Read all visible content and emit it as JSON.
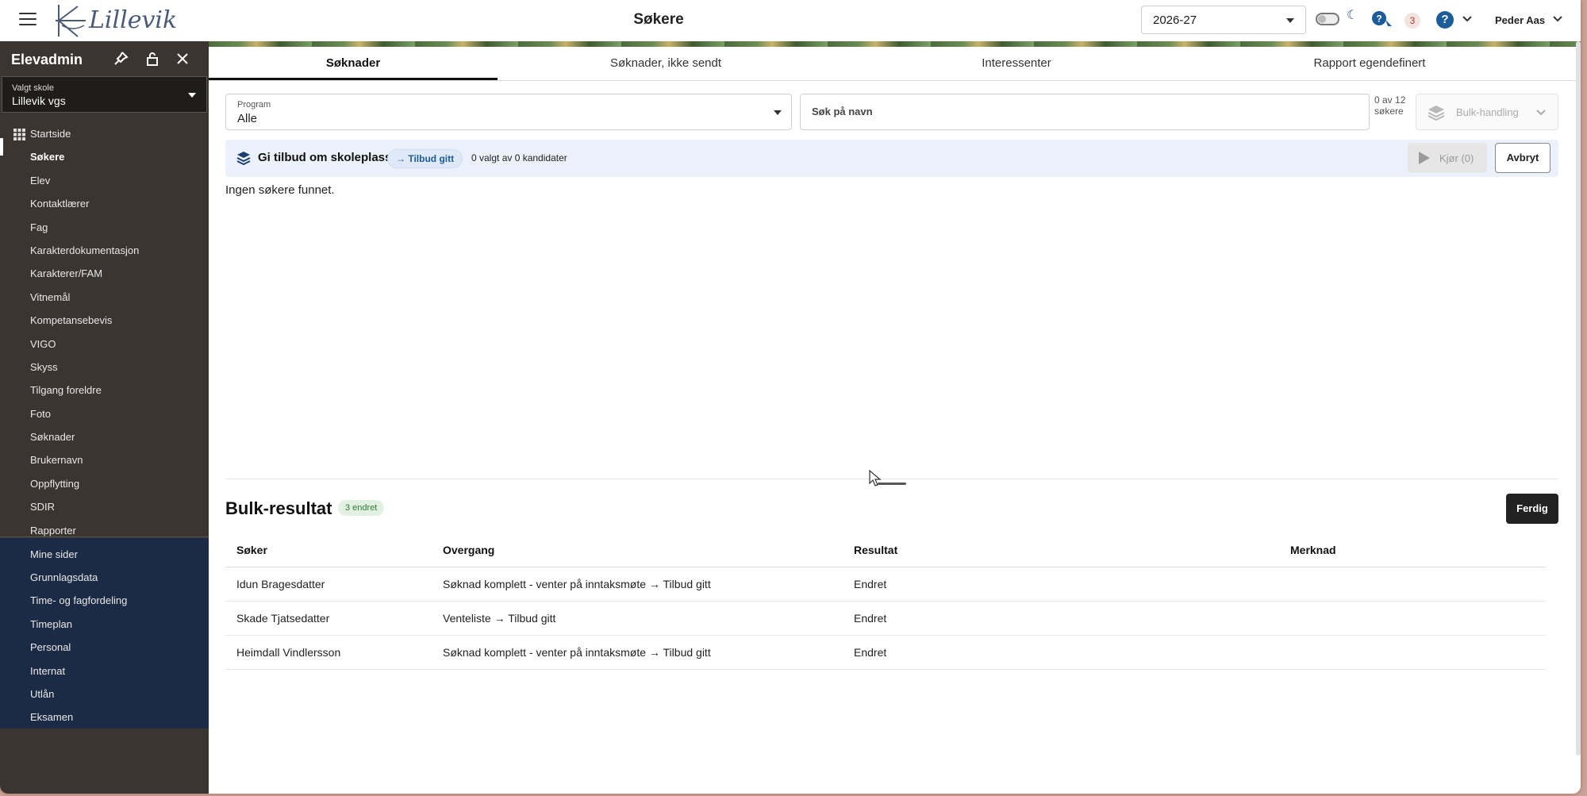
{
  "header": {
    "logo_text": "Lillevik",
    "page_title": "Søkere",
    "year_select_value": "2026-27",
    "notification_count": "3",
    "help_glyph": "?",
    "user_name": "Peder Aas"
  },
  "sidebar": {
    "title": "Elevadmin",
    "school_label": "Valgt skole",
    "school_value": "Lillevik vgs",
    "items": [
      {
        "label": "Startside"
      },
      {
        "label": "Søkere"
      },
      {
        "label": "Elev"
      },
      {
        "label": "Kontaktlærer"
      },
      {
        "label": "Fag"
      },
      {
        "label": "Karakterdokumentasjon"
      },
      {
        "label": "Karakterer/FAM"
      },
      {
        "label": "Vitnemål"
      },
      {
        "label": "Kompetansebevis"
      },
      {
        "label": "VIGO"
      },
      {
        "label": "Skyss"
      },
      {
        "label": "Tilgang foreldre"
      },
      {
        "label": "Foto"
      },
      {
        "label": "Søknader"
      },
      {
        "label": "Brukernavn"
      },
      {
        "label": "Oppflytting"
      },
      {
        "label": "SDIR"
      },
      {
        "label": "Rapporter"
      }
    ],
    "lower_items": [
      {
        "label": "Mine sider"
      },
      {
        "label": "Grunnlagsdata"
      },
      {
        "label": "Time- og fagfordeling"
      },
      {
        "label": "Timeplan"
      },
      {
        "label": "Personal"
      },
      {
        "label": "Internat"
      },
      {
        "label": "Utlån"
      },
      {
        "label": "Eksamen"
      }
    ]
  },
  "tabs": [
    {
      "label": "Søknader"
    },
    {
      "label": "Søknader, ikke sendt"
    },
    {
      "label": "Interessenter"
    },
    {
      "label": "Rapport egendefinert"
    }
  ],
  "filters": {
    "program_label": "Program",
    "program_value": "Alle",
    "search_placeholder": "Søk på navn",
    "count_text": "0 av 12 søkere",
    "bulk_label": "Bulk-handling"
  },
  "offer": {
    "title": "Gi tilbud om skoleplass",
    "pill": "→ Tilbud gitt",
    "selected_text": "0 valgt av 0 kandidater",
    "run_label": "Kjør (0)",
    "cancel_label": "Avbryt"
  },
  "no_results": "Ingen søkere funnet.",
  "bulk_result": {
    "title": "Bulk-resultat",
    "badge": "3 endret",
    "done_label": "Ferdig",
    "columns": [
      "Søker",
      "Overgang",
      "Resultat",
      "Merknad"
    ],
    "rows": [
      {
        "soker": "Idun Bragesdatter",
        "overgang": "Søknad komplett - venter på inntaksmøte → Tilbud gitt",
        "resultat": "Endret",
        "merknad": ""
      },
      {
        "soker": "Skade Tjatsedatter",
        "overgang": "Venteliste → Tilbud gitt",
        "resultat": "Endret",
        "merknad": ""
      },
      {
        "soker": "Heimdall Vindlersson",
        "overgang": "Søknad komplett - venter på inntaksmøte → Tilbud gitt",
        "resultat": "Endret",
        "merknad": ""
      }
    ]
  },
  "colors": {
    "sidebar_bg": "#3a3530",
    "sidebar_lower_bg": "#1c2b45",
    "accent_blue": "#1d5c9a",
    "offer_bar_bg": "#ebf2fb"
  }
}
